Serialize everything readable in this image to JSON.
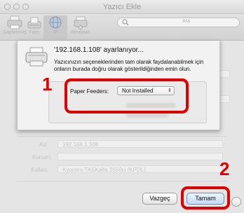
{
  "window": {
    "title": "Yazıcı Ekle"
  },
  "toolbar": {
    "items": [
      {
        "label": "Saptanmış",
        "icon": "printer-icon"
      },
      {
        "label": "Faks",
        "icon": "fax-icon"
      },
      {
        "label": "IP",
        "icon": "globe-icon",
        "selected": true
      },
      {
        "label": "Windows",
        "icon": "windows-printer-icon"
      }
    ],
    "search_label": "Ara"
  },
  "sheet": {
    "title": "'192.168.1.108' ayarlanıyor...",
    "description": "Yazıcınızın seçeneklerinden tam olarak faydalanabilmek için onların burada doğru olarak gösterildiğinden emin olun.",
    "option_label": "Paper Feeders:",
    "option_value": "Not Installed"
  },
  "background_form": {
    "address_label": "Ad:",
    "address_value": "192.168.1.108",
    "location_label": "Konum:",
    "use_label": "Kullan:",
    "use_value": "Kyocera TASKalfa 2550ci (KPDL)"
  },
  "buttons": {
    "cancel": "Vazgeç",
    "ok": "Tamam"
  },
  "annotations": {
    "step1": "1",
    "step2": "2",
    "highlight_color": "#e00000"
  }
}
